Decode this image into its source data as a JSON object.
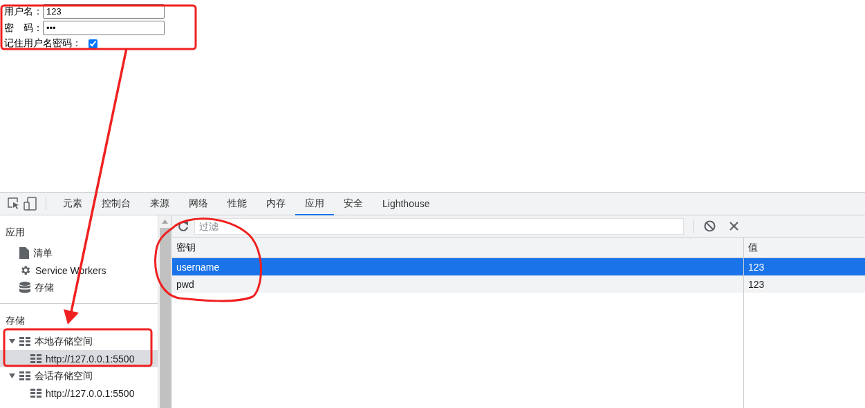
{
  "form": {
    "fields": [
      {
        "label": "用户名：",
        "value": "123"
      },
      {
        "label": "密　码：",
        "value": "•••"
      }
    ],
    "remember": {
      "label": "记住用户名密码：",
      "checked": true
    }
  },
  "devtools": {
    "tabs": [
      {
        "label": "元素",
        "selected": false
      },
      {
        "label": "控制台",
        "selected": false
      },
      {
        "label": "来源",
        "selected": false
      },
      {
        "label": "网络",
        "selected": false
      },
      {
        "label": "性能",
        "selected": false
      },
      {
        "label": "内存",
        "selected": false
      },
      {
        "label": "应用",
        "selected": true
      },
      {
        "label": "安全",
        "selected": false
      },
      {
        "label": "Lighthouse",
        "selected": false
      }
    ],
    "sidebar": {
      "app_section": {
        "title": "应用",
        "items": [
          {
            "label": "清单",
            "kind": "file"
          },
          {
            "label": "Service Workers",
            "kind": "gear"
          },
          {
            "label": "存储",
            "kind": "database"
          }
        ]
      },
      "storage_section": {
        "title": "存储",
        "items": [
          {
            "label": "本地存储空间",
            "expanded": true,
            "children": [
              {
                "label": "http://127.0.0.1:5500",
                "selected": true
              }
            ]
          },
          {
            "label": "会话存储空间",
            "expanded": true,
            "children": [
              {
                "label": "http://127.0.0.1:5500",
                "selected": false
              }
            ]
          }
        ]
      }
    },
    "filter": {
      "placeholder": "过滤"
    },
    "table": {
      "columns": [
        "密钥",
        "值"
      ],
      "rows": [
        {
          "cells": [
            "username",
            "123"
          ],
          "selected": true
        },
        {
          "cells": [
            "pwd",
            "123"
          ],
          "selected": false
        }
      ]
    }
  }
}
